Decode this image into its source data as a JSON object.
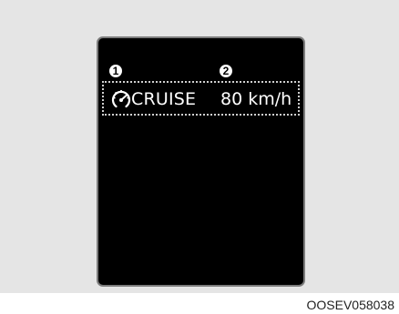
{
  "display": {
    "cruise_label": "CRUISE",
    "cruise_speed": "80 km/h",
    "cruise_icon": "cruise-control-icon"
  },
  "callouts": {
    "one": "1",
    "two": "2"
  },
  "footer": {
    "code": "OOSEV058038"
  },
  "colors": {
    "background": "#e5e5e5",
    "display": "#000000",
    "display_border": "#7c7c7c",
    "text": "#ffffff"
  }
}
